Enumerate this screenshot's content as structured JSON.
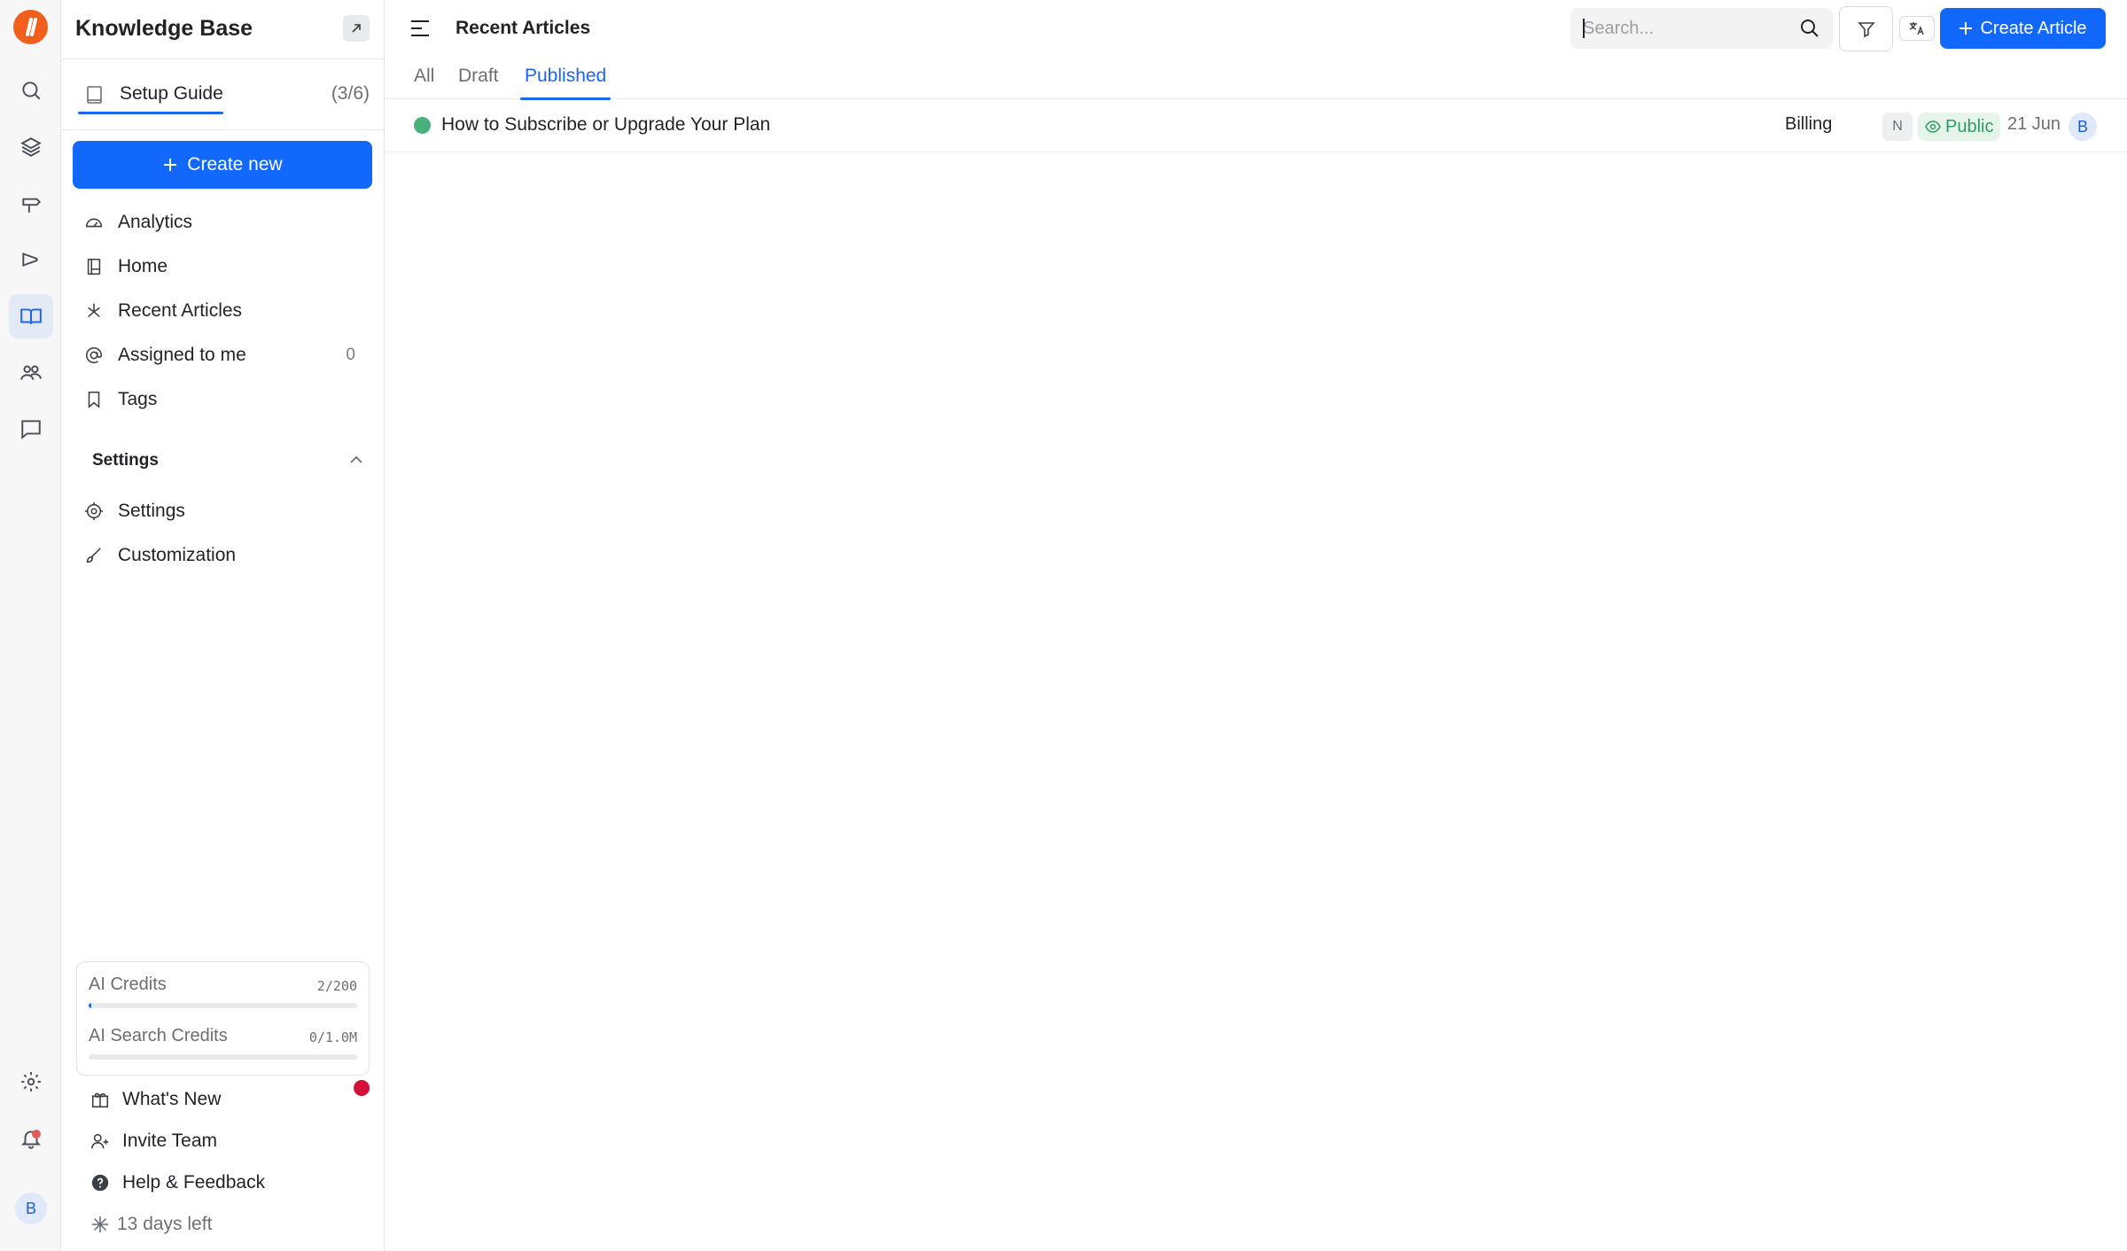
{
  "sidebar": {
    "title": "Knowledge Base",
    "setup": {
      "label": "Setup Guide",
      "count": "(3/6)"
    },
    "create_new": "Create new",
    "nav": [
      {
        "label": "Analytics"
      },
      {
        "label": "Home"
      },
      {
        "label": "Recent Articles"
      },
      {
        "label": "Assigned to me",
        "badge": "0"
      },
      {
        "label": "Tags"
      }
    ],
    "settings_section": {
      "title": "Settings",
      "items": [
        {
          "label": "Settings"
        },
        {
          "label": "Customization"
        }
      ]
    },
    "credits": [
      {
        "label": "AI Credits",
        "value": "2/200",
        "fraction": 0.01
      },
      {
        "label": "AI Search Credits",
        "value": "0/1.0M",
        "fraction": 0.0
      }
    ],
    "footer": [
      {
        "label": "What's New"
      },
      {
        "label": "Invite Team"
      },
      {
        "label": "Help & Feedback"
      },
      {
        "label": "13 days left"
      }
    ]
  },
  "rail": {
    "avatar": "B",
    "icons": [
      "search-icon",
      "layers-icon",
      "signpost-icon",
      "megaphone-icon",
      "book-open-icon",
      "users-icon",
      "chat-icon",
      "gear-icon",
      "bell-icon"
    ]
  },
  "header": {
    "title": "Recent Articles",
    "search_placeholder": "Search...",
    "create_article": "Create Article"
  },
  "tabs": [
    {
      "label": "All",
      "active": false
    },
    {
      "label": "Draft",
      "active": false
    },
    {
      "label": "Published",
      "active": true
    }
  ],
  "articles": [
    {
      "title": "How to Subscribe or Upgrade Your Plan",
      "category": "Billing",
      "lang_badge": "N",
      "visibility": "Public",
      "date": "21 Jun",
      "author_initial": "B",
      "status_color": "#49b27c"
    }
  ],
  "colors": {
    "accent": "#1268fb",
    "brand": "#f25f1c",
    "public_green": "#2f9a62",
    "alert_red": "#d5103c"
  }
}
